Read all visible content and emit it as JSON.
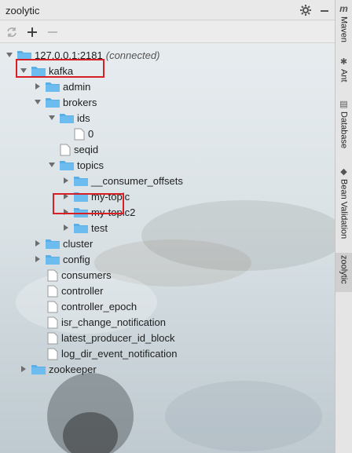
{
  "panel": {
    "title": "zoolytic"
  },
  "tree": {
    "server": {
      "label": "127.0.0.1:2181",
      "status": "(connected)"
    },
    "kafka": "kafka",
    "admin": "admin",
    "brokers": "brokers",
    "ids": "ids",
    "id0": "0",
    "seqid": "seqid",
    "topics": "topics",
    "consumer_offsets": "__consumer_offsets",
    "my_topic": "my-topic",
    "my_topic2": "my-topic2",
    "test": "test",
    "cluster": "cluster",
    "config": "config",
    "consumers": "consumers",
    "controller": "controller",
    "controller_epoch": "controller_epoch",
    "isr_change_notification": "isr_change_notification",
    "latest_producer_id_block": "latest_producer_id_block",
    "log_dir_event_notification": "log_dir_event_notification",
    "zookeeper": "zookeeper"
  },
  "strip": {
    "maven": "Maven",
    "ant": "Ant",
    "database": "Database",
    "bean_validation": "Bean Validation",
    "zoolytic": "zoolytic"
  },
  "colors": {
    "folder": "#5aaee3",
    "highlight": "#d91f26"
  }
}
